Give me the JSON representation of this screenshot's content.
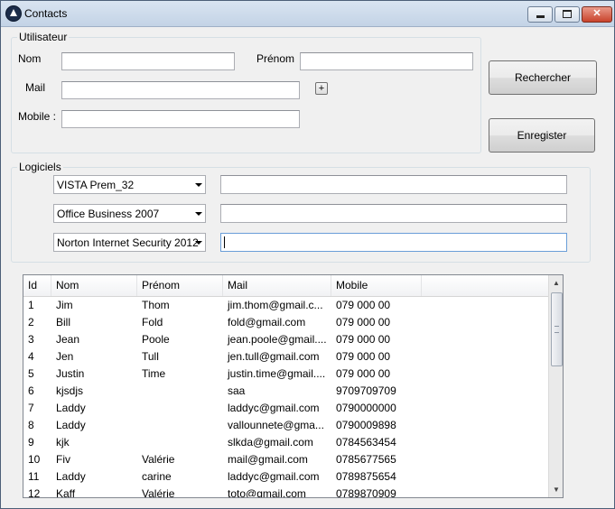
{
  "window": {
    "title": "Contacts"
  },
  "utilisateur": {
    "legend": "Utilisateur",
    "nom_label": "Nom",
    "nom_value": "",
    "prenom_label": "Prénom",
    "prenom_value": "",
    "mail_label": "Mail",
    "mail_value": "",
    "add_mail_label": "+",
    "mobile_label": "Mobile :",
    "mobile_value": ""
  },
  "actions": {
    "search_label": "Rechercher",
    "save_label": "Enregister"
  },
  "logiciels": {
    "legend": "Logiciels",
    "items": [
      {
        "selected": "VISTA Prem_32",
        "value": ""
      },
      {
        "selected": "Office Business 2007",
        "value": ""
      },
      {
        "selected": "Norton Internet Security 2012",
        "value": ""
      }
    ]
  },
  "grid": {
    "columns": [
      "Id",
      "Nom",
      "Prénom",
      "Mail",
      "Mobile"
    ],
    "rows": [
      [
        "1",
        "Jim",
        "Thom",
        "jim.thom@gmail.c...",
        "079 000 00"
      ],
      [
        "2",
        "Bill",
        "Fold",
        "fold@gmail.com",
        "079 000 00"
      ],
      [
        "3",
        "Jean",
        "Poole",
        "jean.poole@gmail....",
        "079 000 00"
      ],
      [
        "4",
        "Jen",
        "Tull",
        "jen.tull@gmail.com",
        "079 000 00"
      ],
      [
        "5",
        "Justin",
        "Time",
        "justin.time@gmail....",
        "079 000 00"
      ],
      [
        "6",
        "kjsdjs",
        "",
        "saa",
        "9709709709"
      ],
      [
        "7",
        "Laddy",
        "",
        "laddyc@gmail.com",
        "0790000000"
      ],
      [
        "8",
        "Laddy",
        "",
        "vallounnete@gma...",
        "0790009898"
      ],
      [
        "9",
        "kjk",
        "",
        "slkda@gmail.com",
        "0784563454"
      ],
      [
        "10",
        "Fiv",
        "Valérie",
        "mail@gmail.com",
        "0785677565"
      ],
      [
        "11",
        "Laddy",
        "carine",
        "laddyc@gmail.com",
        "0789875654"
      ],
      [
        "12",
        "Kaff",
        "Valérie",
        "toto@gmail.com",
        "0789870909"
      ]
    ]
  },
  "icons": {
    "app": "app-logo-icon",
    "minimize": "minimize-icon",
    "maximize": "maximize-icon",
    "close": "close-icon",
    "dropdown": "chevron-down-icon",
    "scroll_up": "scroll-up-icon",
    "scroll_down": "scroll-down-icon"
  },
  "colors": {
    "titlebar": "#c8d6e9",
    "close_button": "#c9432c",
    "window_bg": "#f0f0f0",
    "focus_border": "#6a9ed8"
  }
}
